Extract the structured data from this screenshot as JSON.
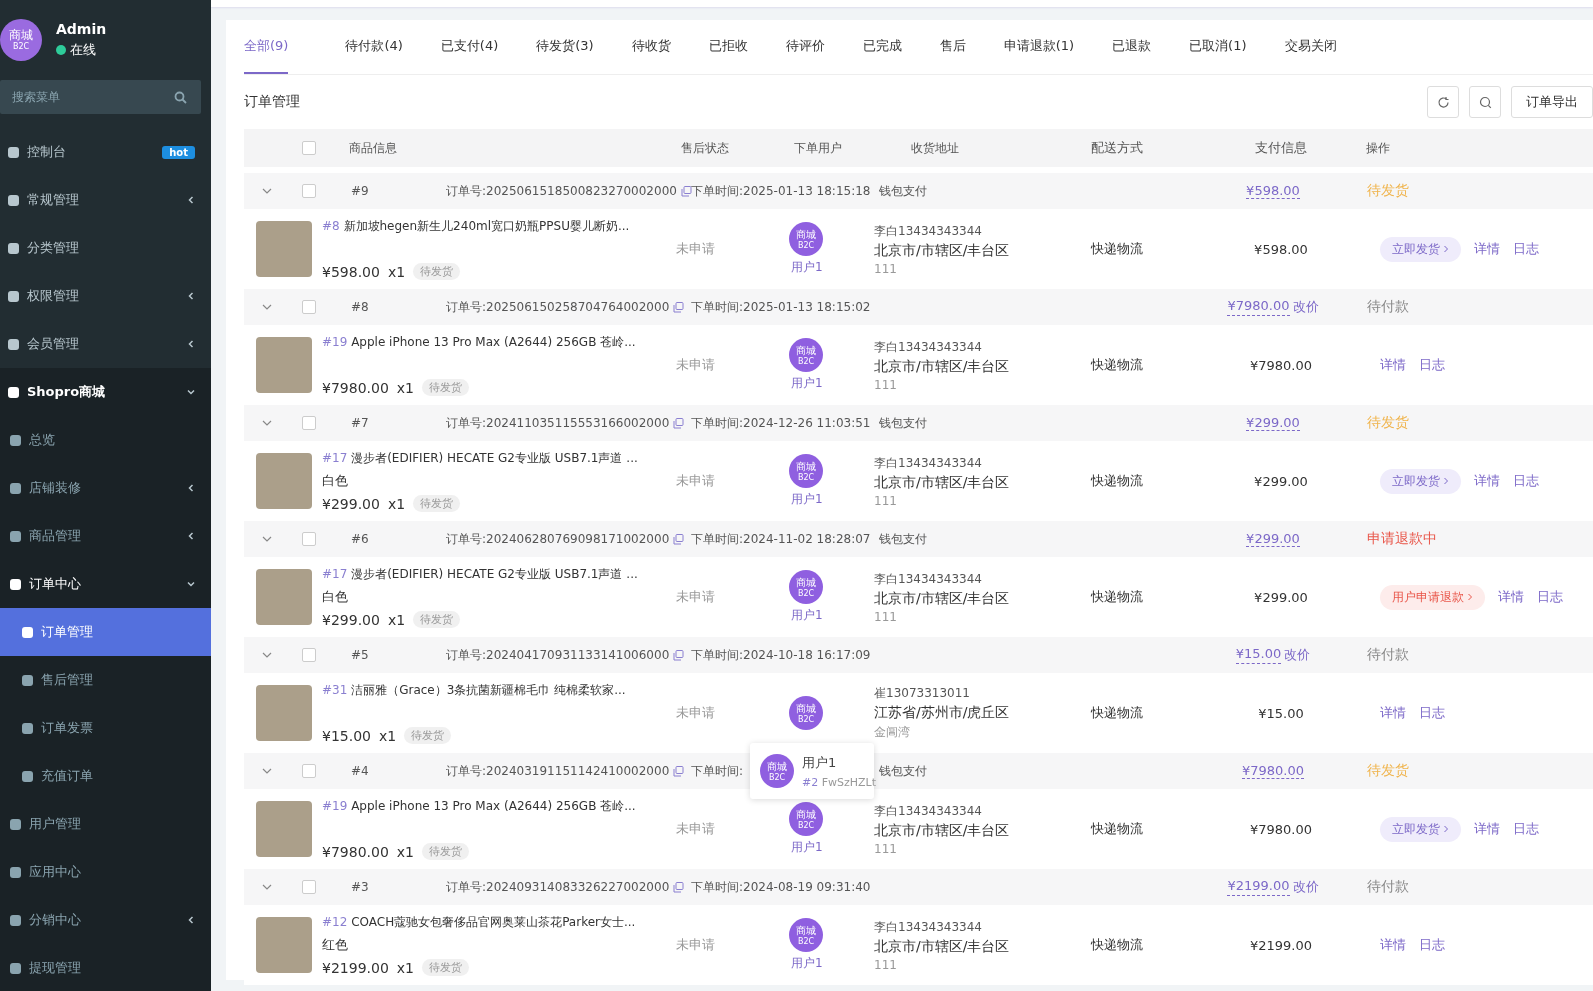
{
  "sidebar": {
    "profile": {
      "avatar_text": "商城",
      "avatar_sub": "B2C",
      "name": "Admin",
      "status": "在线",
      "online": true
    },
    "search": {
      "placeholder": "搜索菜单"
    },
    "items": [
      {
        "label": "控制台",
        "badge": "hot",
        "has_children": false,
        "expanded": false,
        "selected": false
      },
      {
        "label": "常规管理",
        "has_children": true,
        "expanded": false,
        "selected": false
      },
      {
        "label": "分类管理",
        "has_children": false,
        "expanded": false,
        "selected": false
      },
      {
        "label": "权限管理",
        "has_children": true,
        "expanded": false,
        "selected": false
      },
      {
        "label": "会员管理",
        "has_children": true,
        "expanded": false,
        "selected": false
      },
      {
        "label": "Shopro商城",
        "has_children": true,
        "expanded": true,
        "selected": false,
        "children": [
          {
            "label": "总览",
            "has_children": false,
            "expanded": false,
            "selected": false
          },
          {
            "label": "店铺装修",
            "has_children": true,
            "expanded": false,
            "selected": false
          },
          {
            "label": "商品管理",
            "has_children": true,
            "expanded": false,
            "selected": false
          },
          {
            "label": "订单中心",
            "has_children": true,
            "expanded": true,
            "selected": false,
            "children": [
              {
                "label": "订单管理",
                "selected": true
              },
              {
                "label": "售后管理",
                "selected": false
              },
              {
                "label": "订单发票",
                "selected": false
              },
              {
                "label": "充值订单",
                "selected": false
              }
            ]
          },
          {
            "label": "用户管理",
            "has_children": false,
            "expanded": false,
            "selected": false
          },
          {
            "label": "应用中心",
            "has_children": false,
            "expanded": false,
            "selected": false
          },
          {
            "label": "分销中心",
            "has_children": true,
            "expanded": false,
            "selected": false
          },
          {
            "label": "提现管理",
            "has_children": false,
            "expanded": false,
            "selected": false
          }
        ]
      }
    ]
  },
  "tabs": [
    {
      "label": "全部(9)",
      "selected": true
    },
    {
      "label": "待付款(4)",
      "selected": false
    },
    {
      "label": "已支付(4)",
      "selected": false
    },
    {
      "label": "待发货(3)",
      "selected": false
    },
    {
      "label": "待收货",
      "selected": false
    },
    {
      "label": "已拒收",
      "selected": false
    },
    {
      "label": "待评价",
      "selected": false
    },
    {
      "label": "已完成",
      "selected": false
    },
    {
      "label": "售后",
      "selected": false
    },
    {
      "label": "申请退款(1)",
      "selected": false
    },
    {
      "label": "已退款",
      "selected": false
    },
    {
      "label": "已取消(1)",
      "selected": false
    },
    {
      "label": "交易关闭",
      "selected": false
    }
  ],
  "page_title": "订单管理",
  "toolbar": {
    "export_button": "订单导出"
  },
  "table": {
    "select_all_checked": false,
    "columns": [
      "商品信息",
      "售后状态",
      "下单用户",
      "收货地址",
      "配送方式",
      "支付信息",
      "操作"
    ],
    "orders": [
      {
        "id": "#9",
        "order_no": "订单号:2025061518500823270002000",
        "time": "下单时间:2025-01-13 18:15:18",
        "pay_method": "钱包支付",
        "amount": "¥598.00",
        "status": "待发货",
        "color": "#f0b44c",
        "checked": false,
        "product": {
          "id": "#8",
          "name": "新加坡hegen新生儿240ml宽口奶瓶PPSU婴儿断奶...",
          "price": "¥598.00",
          "qty": "x1",
          "tag": "待发货"
        },
        "after_sales": "未申请",
        "user": {
          "avatar_text": "商城",
          "avatar_sub": "B2C",
          "name": "用户1"
        },
        "address": {
          "contact": "李白13434343344",
          "region": "北京市/市辖区/丰台区",
          "detail": "111"
        },
        "delivery": "快递物流",
        "total": "¥598.00",
        "actions": [
          {
            "kind": "ship",
            "label": "立即发货"
          },
          {
            "kind": "link",
            "label": "详情"
          },
          {
            "kind": "link",
            "label": "日志"
          }
        ]
      },
      {
        "id": "#8",
        "order_no": "订单号:202506150258704764002000",
        "time": "下单时间:2025-01-13 18:15:02",
        "amount": "¥7980.00",
        "edit_price": "改价",
        "status": "待付款",
        "color": "#888888",
        "checked": false,
        "product": {
          "id": "#19",
          "name": "Apple iPhone 13 Pro Max (A2644) 256GB 苍岭...",
          "price": "¥7980.00",
          "qty": "x1",
          "tag": "待发货"
        },
        "after_sales": "未申请",
        "user": {
          "avatar_text": "商城",
          "avatar_sub": "B2C",
          "name": "用户1"
        },
        "address": {
          "contact": "李白13434343344",
          "region": "北京市/市辖区/丰台区",
          "detail": "111"
        },
        "delivery": "快递物流",
        "total": "¥7980.00",
        "actions": [
          {
            "kind": "link",
            "label": "详情"
          },
          {
            "kind": "link",
            "label": "日志"
          }
        ]
      },
      {
        "id": "#7",
        "order_no": "订单号:202411035115553166002000",
        "time": "下单时间:2024-12-26 11:03:51",
        "pay_method": "钱包支付",
        "amount": "¥299.00",
        "status": "待发货",
        "color": "#f0b44c",
        "checked": false,
        "product": {
          "id": "#17",
          "name": "漫步者(EDIFIER) HECATE G2专业版 USB7.1声道 ...",
          "spec": "白色",
          "price": "¥299.00",
          "qty": "x1",
          "tag": "待发货"
        },
        "after_sales": "未申请",
        "user": {
          "avatar_text": "商城",
          "avatar_sub": "B2C",
          "name": "用户1"
        },
        "address": {
          "contact": "李白13434343344",
          "region": "北京市/市辖区/丰台区",
          "detail": "111"
        },
        "delivery": "快递物流",
        "total": "¥299.00",
        "actions": [
          {
            "kind": "ship",
            "label": "立即发货"
          },
          {
            "kind": "link",
            "label": "详情"
          },
          {
            "kind": "link",
            "label": "日志"
          }
        ]
      },
      {
        "id": "#6",
        "order_no": "订单号:202406280769098171002000",
        "time": "下单时间:2024-11-02 18:28:07",
        "pay_method": "钱包支付",
        "amount": "¥299.00",
        "status": "申请退款中",
        "color": "#e9564a",
        "checked": false,
        "product": {
          "id": "#17",
          "name": "漫步者(EDIFIER) HECATE G2专业版 USB7.1声道 ...",
          "spec": "白色",
          "price": "¥299.00",
          "qty": "x1",
          "tag": "待发货"
        },
        "after_sales": "未申请",
        "user": {
          "avatar_text": "商城",
          "avatar_sub": "B2C",
          "name": "用户1"
        },
        "address": {
          "contact": "李白13434343344",
          "region": "北京市/市辖区/丰台区",
          "detail": "111"
        },
        "delivery": "快递物流",
        "total": "¥299.00",
        "actions": [
          {
            "kind": "refund",
            "label": "用户申请退款"
          },
          {
            "kind": "link",
            "label": "详情"
          },
          {
            "kind": "link",
            "label": "日志"
          }
        ]
      },
      {
        "id": "#5",
        "order_no": "订单号:202404170931133141006000",
        "time": "下单时间:2024-10-18 16:17:09",
        "amount": "¥15.00",
        "edit_price": "改价",
        "status": "待付款",
        "color": "#888888",
        "checked": false,
        "product": {
          "id": "#31",
          "name": "洁丽雅（Grace）3条抗菌新疆棉毛巾 纯棉柔软家...",
          "price": "¥15.00",
          "qty": "x1",
          "tag": "待发货"
        },
        "after_sales": "未申请",
        "user": {
          "avatar_text": "商城",
          "avatar_sub": "B2C"
        },
        "address": {
          "contact": "崔13073313011",
          "region": "江苏省/苏州市/虎丘区",
          "detail": "金阊湾"
        },
        "delivery": "快递物流",
        "total": "¥15.00",
        "actions": [
          {
            "kind": "link",
            "label": "详情"
          },
          {
            "kind": "link",
            "label": "日志"
          }
        ]
      },
      {
        "id": "#4",
        "order_no": "订单号:202403191151142410002000",
        "time": "下单时间:",
        "pay_method": "钱包支付",
        "amount": "¥7980.00",
        "status": "待发货",
        "color": "#f0b44c",
        "checked": false,
        "product": {
          "id": "#19",
          "name": "Apple iPhone 13 Pro Max (A2644) 256GB 苍岭...",
          "price": "¥7980.00",
          "qty": "x1",
          "tag": "待发货"
        },
        "after_sales": "未申请",
        "user": {
          "avatar_text": "商城",
          "avatar_sub": "B2C",
          "name": "用户1"
        },
        "address": {
          "contact": "李白13434343344",
          "region": "北京市/市辖区/丰台区",
          "detail": "111"
        },
        "delivery": "快递物流",
        "total": "¥7980.00",
        "actions": [
          {
            "kind": "ship",
            "label": "立即发货"
          },
          {
            "kind": "link",
            "label": "详情"
          },
          {
            "kind": "link",
            "label": "日志"
          }
        ]
      },
      {
        "id": "#3",
        "order_no": "订单号:202409314083326227002000",
        "time": "下单时间:2024-08-19 09:31:40",
        "amount": "¥2199.00",
        "edit_price": "改价",
        "status": "待付款",
        "color": "#888888",
        "checked": false,
        "product": {
          "id": "#12",
          "name": "COACH蔻驰女包奢侈品官网奥莱山茶花Parker女士...",
          "spec": "红色",
          "price": "¥2199.00",
          "qty": "x1",
          "tag": "待发货"
        },
        "after_sales": "未申请",
        "user": {
          "avatar_text": "商城",
          "avatar_sub": "B2C",
          "name": "用户1"
        },
        "address": {
          "contact": "李白13434343344",
          "region": "北京市/市辖区/丰台区",
          "detail": "111"
        },
        "delivery": "快递物流",
        "total": "¥2199.00",
        "actions": [
          {
            "kind": "link",
            "label": "详情"
          },
          {
            "kind": "link",
            "label": "日志"
          }
        ]
      }
    ]
  },
  "user_tooltip": {
    "avatar_text": "商城",
    "avatar_sub": "B2C",
    "name": "用户1",
    "id": "#2",
    "code": "FwSzHZLt"
  }
}
